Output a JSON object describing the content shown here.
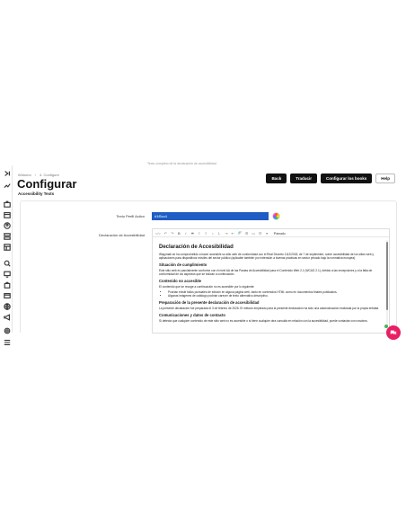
{
  "breadcrumb": [
    "Widomo",
    "4. Configure"
  ],
  "page": {
    "title": "Configurar",
    "subtitle": "Accessibility Texts"
  },
  "actions": {
    "back": "Back",
    "translate": "Traducir",
    "configure_books": "Configurar los books",
    "help": "Help"
  },
  "fields": {
    "color_label": "Texto Perfil Activo",
    "color_value": "#1f5cc4",
    "color_text": "#1f5cc4",
    "declaration_label": "Declaración de Accesibilidad"
  },
  "toolbar": {
    "buttons": [
      "</>",
      "↶",
      "↷",
      "B",
      "I",
      "S",
      "≡",
      "≡",
      "•",
      "1.",
      "⇥",
      "⇤",
      "🔗",
      "⊞",
      "▭",
      "⊟",
      "▾"
    ],
    "format_select": "Párrafo"
  },
  "document": {
    "title": "Declaración de Accesibilidad",
    "intro": "Wayymab se ha comprometido a hacer accesible su sitio web de conformidad con el Real Decreto 1112/2018, de 7 de septiembre, sobre accesibilidad de los sitios web y aplicaciones para dispositivos móviles del sector público (aplicable también por extensión a buenas prácticas en sector privado bajo la normativa europea).",
    "h_situation": "Situación de cumplimiento",
    "p_situation": "Este sitio web es parcialmente conforme con el nivel AA de las Pautas de Accesibilidad para el Contenido Web 2.1 (WCAG 2.1), debido a las excepciones y a la falta de conformidad de los aspectos que se indican a continuación.",
    "h_not_accessible": "Contenido no accesible",
    "p_not_accessible": "El contenido que se recoge a continuación no es accesible por lo siguiente:",
    "list": [
      "Podrían existir fallos puntuales de edición en alguna página web, tanto en contenidos HTML como en documentos finales publicados.",
      "Algunas imágenes de catálogo podrían carecer de texto alternativo descriptivo."
    ],
    "h_preparation": "Preparación de la presente declaración de accesibilidad",
    "p_preparation": "La presente declaración fue preparada el 3 de febrero de 2026. El método empleado para la presente declaración ha sido una autoevaluación realizada por la propia entidad.",
    "h_contact": "Comunicaciones y datos de contacto",
    "p_contact": "Si detecta que cualquier contenido de este sitio web no es accesible o si tiene cualquier otra consulta en relación con la accesibilidad, puede contactar con nosotros."
  },
  "footnote": "Texto completo de la declaración de accesibilidad",
  "sidebar_icons": [
    "chevron-right-icon",
    "trend-icon",
    "briefcase-icon",
    "calendar-icon",
    "user-icon",
    "layers-icon",
    "calendar-grid-icon",
    "search-icon",
    "monitor-icon",
    "bag-icon",
    "card-icon",
    "globe-icon",
    "megaphone-icon",
    "gear-icon",
    "list-icon"
  ]
}
